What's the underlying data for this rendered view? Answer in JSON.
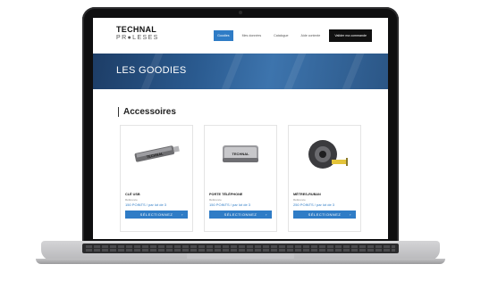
{
  "brand": {
    "line1": "TECHNAL",
    "line2": "PR●LESES"
  },
  "nav": {
    "items": [
      "Goodies",
      "Mes données",
      "Catalogue",
      "Aide contexte"
    ],
    "cta": "Valider ma commande"
  },
  "banner": {
    "title": "LES GOODIES"
  },
  "section": {
    "title": "Accessoires"
  },
  "products": [
    {
      "name": "CLÉ USB",
      "ref": "Référence",
      "price": "150 POINTS / par lot de 3",
      "button": "SÉLECTIONNEZ",
      "icon": "usb-key-icon"
    },
    {
      "name": "PORTE TÉLÉPHONE",
      "ref": "Référence",
      "price": "150 POINTS / par lot de 3",
      "button": "SÉLECTIONNEZ",
      "icon": "phone-holder-icon"
    },
    {
      "name": "MÈTRES-RUBAN",
      "ref": "Référence",
      "price": "250 POINTS / par lot de 3",
      "button": "SÉLECTIONNEZ",
      "icon": "tape-measure-icon"
    }
  ],
  "colors": {
    "accent": "#2f7cc6",
    "banner": "#2a5a8f",
    "cta": "#111111"
  }
}
